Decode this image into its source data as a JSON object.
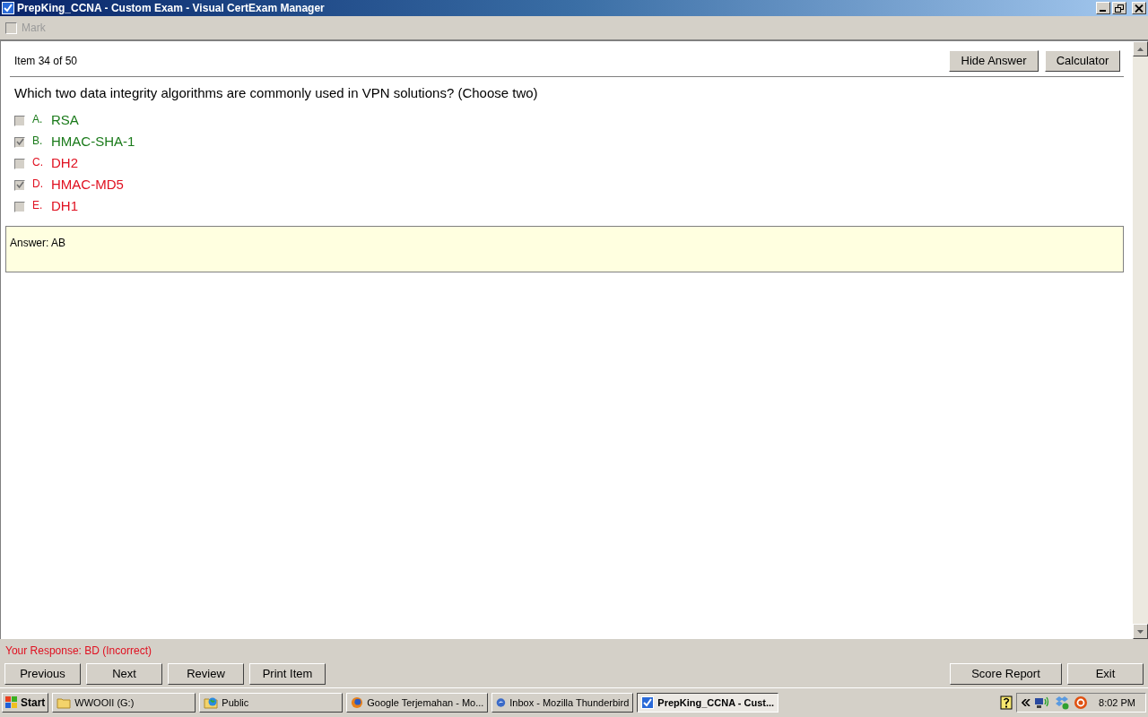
{
  "window": {
    "title": "PrepKing_CCNA - Custom Exam - Visual CertExam Manager"
  },
  "mark": {
    "label": "Mark",
    "checked": false,
    "disabled": true
  },
  "item_counter": "Item 34 of 50",
  "top_buttons": [
    "Hide Answer",
    "Calculator"
  ],
  "question": "Which two data integrity algorithms are commonly used in VPN solutions? (Choose two)",
  "options": [
    {
      "letter": "A.",
      "text": "RSA",
      "checked": false,
      "color": "#1a7a1a"
    },
    {
      "letter": "B.",
      "text": "HMAC-SHA-1",
      "checked": true,
      "color": "#1a7a1a"
    },
    {
      "letter": "C.",
      "text": "DH2",
      "checked": false,
      "color": "#e01020"
    },
    {
      "letter": "D.",
      "text": "HMAC-MD5",
      "checked": true,
      "color": "#e01020"
    },
    {
      "letter": "E.",
      "text": "DH1",
      "checked": false,
      "color": "#e01020"
    }
  ],
  "answer": "Answer: AB",
  "response": "Your Response: BD (Incorrect)",
  "nav_buttons": [
    "Previous",
    "Next",
    "Review",
    "Print Item"
  ],
  "right_buttons": [
    "Score Report",
    "Exit"
  ],
  "taskbar": {
    "start": "Start",
    "items": [
      {
        "label": "WWOOII (G:)",
        "kind": "folder",
        "selected": false
      },
      {
        "label": "Public",
        "kind": "globe",
        "selected": false
      },
      {
        "label": "Google Terjemahan - Mo...",
        "kind": "firefox",
        "selected": false
      },
      {
        "label": "Inbox - Mozilla Thunderbird",
        "kind": "mail",
        "selected": false
      },
      {
        "label": "PrepKing_CCNA - Cust...",
        "kind": "check",
        "selected": true
      }
    ],
    "clock": "8:02 PM"
  }
}
